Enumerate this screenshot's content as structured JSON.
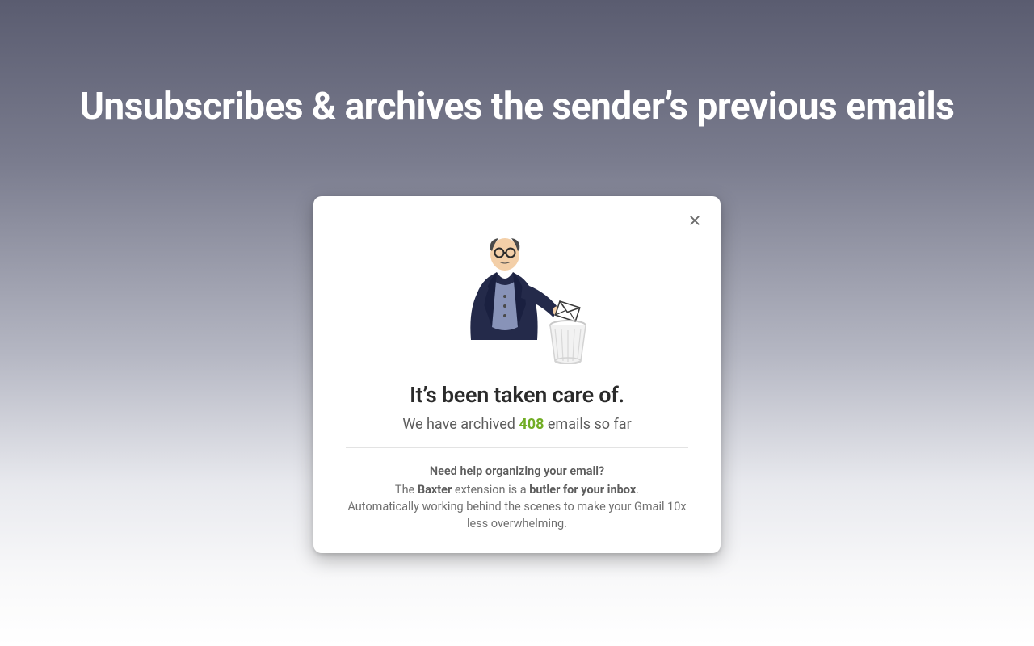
{
  "headline": "Unsubscribes & archives the sender’s previous emails",
  "card": {
    "title": "It’s been taken care of.",
    "sub_prefix": "We have archived ",
    "count": "408",
    "sub_suffix": " emails so far",
    "promo": {
      "question": "Need help organizing your email?",
      "line2_a": "The ",
      "brand": "Baxter",
      "line2_b": " extension is a ",
      "tagline": "butler for your inbox",
      "line2_c": ".",
      "line3": "Automatically working behind the scenes to make your Gmail 10x less overwhelming."
    }
  }
}
